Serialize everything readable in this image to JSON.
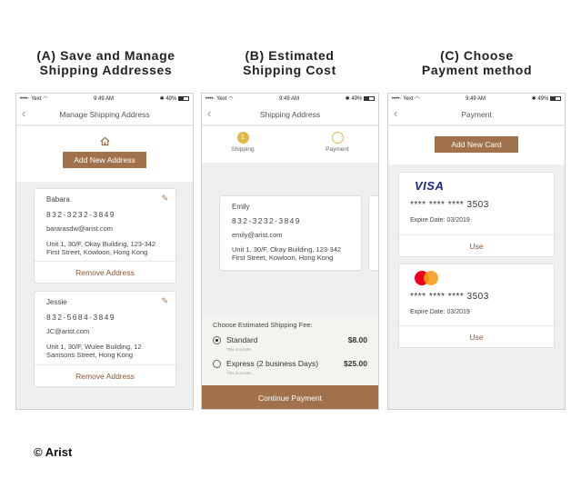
{
  "sections": {
    "a": {
      "line1": "(A) Save and Manage",
      "line2": "Shipping Addresses"
    },
    "b": {
      "line1": "(B) Estimated",
      "line2": "Shipping Cost"
    },
    "c": {
      "line1": "(C) Choose",
      "line2": "Payment method"
    }
  },
  "status": {
    "carrier": "••••◦ Yext ◠",
    "time": "9:49 AM",
    "battery": "✱ 49%"
  },
  "screen_a": {
    "title": "Manage Shipping Address",
    "add_button": "Add New Address",
    "addresses": [
      {
        "name": "Babara",
        "phone": "832-3232-3849",
        "email": "bararasdw@arist.com",
        "addr1": "Unit 1, 30/F, Okay Building, 123-342",
        "addr2": "First Street, Kowloon, Hong Kong",
        "remove": "Remove Address"
      },
      {
        "name": "Jessie",
        "phone": "832-5684-3849",
        "email": "JC@arist.com",
        "addr1": "Unit 1, 30/F, Wulee Building, 12",
        "addr2": "Samsons Street, Hong Kong",
        "remove": "Remove Address"
      }
    ]
  },
  "screen_b": {
    "title": "Shipping Address",
    "steps": [
      {
        "num": "1",
        "label": "Shipping"
      },
      {
        "num": "",
        "label": "Payment"
      }
    ],
    "address": {
      "name": "Emily",
      "phone": "832-3232-3849",
      "email": "emily@arist.com",
      "addr1": "Unit 1, 30/F, Okay Building, 123-342",
      "addr2": "First Street, Kowloon, Hong Kong"
    },
    "fee_heading": "Choose Estimated Shipping Fee:",
    "options": [
      {
        "label": "Standard",
        "note": "This is a note.",
        "price": "$8.00",
        "selected": true
      },
      {
        "label": "Express (2 business Days)",
        "note": "This is a note.",
        "price": "$25.00",
        "selected": false
      }
    ],
    "continue": "Continue Payment"
  },
  "screen_c": {
    "title": "Payment",
    "add_button": "Add New Card",
    "cards": [
      {
        "brand": "VISA",
        "number": "**** **** **** 3503",
        "expiry": "Expire Date: 03/2019",
        "use": "Use"
      },
      {
        "brand": "mastercard",
        "number": "**** **** **** 3503",
        "expiry": "Expire Date: 03/2019",
        "use": "Use"
      }
    ]
  },
  "footer": {
    "copyright": "© Arist"
  },
  "colors": {
    "accent": "#a0714b",
    "step_active": "#e3b84a"
  }
}
